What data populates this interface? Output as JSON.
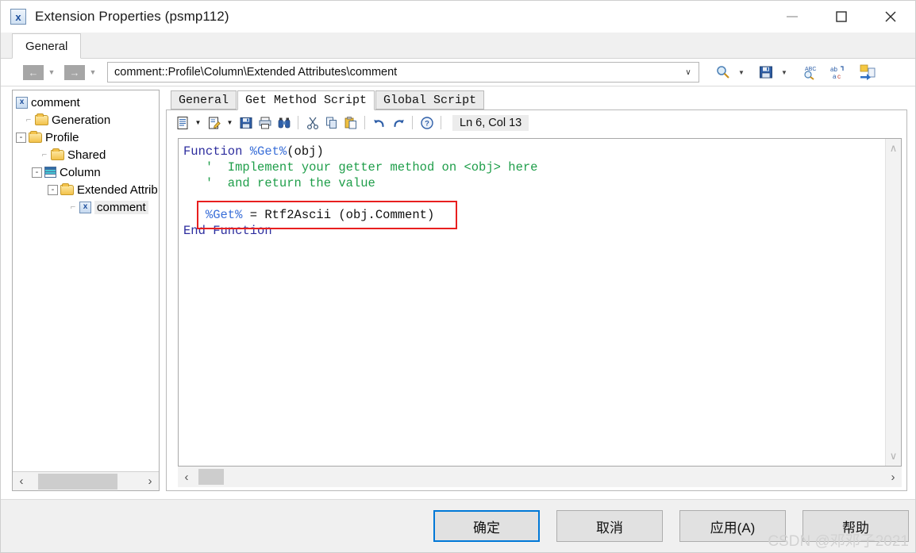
{
  "window": {
    "title": "Extension Properties (psmp112)",
    "app_icon_glyph": "x",
    "controls": {
      "minimize": "minimize-icon",
      "maximize": "maximize-icon",
      "close": "close-icon"
    }
  },
  "outer_tabs": [
    {
      "label": "General",
      "active": true
    }
  ],
  "navbar": {
    "back_label": "←",
    "forward_label": "→",
    "caret": "▼",
    "address_value": "comment::Profile\\Column\\Extended Attributes\\comment",
    "address_placeholder": "",
    "dropdown_caret": "∨",
    "tools": [
      {
        "name": "search-icon",
        "label": "Find"
      },
      {
        "name": "search-dropdown-caret",
        "label": "▼"
      },
      {
        "name": "save-icon",
        "label": "Save"
      },
      {
        "name": "save-dropdown-caret",
        "label": "▼"
      },
      {
        "name": "spell-check-icon",
        "label": "Check Spelling"
      },
      {
        "name": "replace-icon",
        "label": "Replace"
      },
      {
        "name": "export-icon",
        "label": "Export"
      }
    ]
  },
  "tree": {
    "nodes": [
      {
        "depth": 0,
        "expander": "",
        "icon": "xdoc",
        "label": "comment",
        "selected": false
      },
      {
        "depth": 1,
        "expander": "",
        "icon": "folder",
        "label": "Generation",
        "selected": false
      },
      {
        "depth": 0,
        "expander": "-",
        "icon": "folder",
        "label": "Profile",
        "selected": false
      },
      {
        "depth": 2,
        "expander": "",
        "icon": "folder",
        "label": "Shared",
        "selected": false
      },
      {
        "depth": 1,
        "expander": "-",
        "icon": "grid",
        "label": "Column",
        "selected": false
      },
      {
        "depth": 2,
        "expander": "-",
        "icon": "folder",
        "label": "Extended Attrib",
        "selected": false
      },
      {
        "depth": 4,
        "expander": "",
        "icon": "xdoc",
        "label": "comment",
        "selected": true
      }
    ],
    "hscroll": {
      "left_arrow": "‹",
      "right_arrow": "›"
    }
  },
  "inner_tabs": [
    {
      "label": "General",
      "active": false
    },
    {
      "label": "Get Method Script",
      "active": true
    },
    {
      "label": "Global Script",
      "active": false
    }
  ],
  "editor": {
    "toolbar": [
      {
        "name": "open-script-icon",
        "label": "Open"
      },
      {
        "name": "open-dropdown-caret",
        "label": "▼"
      },
      {
        "name": "edit-script-icon",
        "label": "Edit"
      },
      {
        "name": "edit-dropdown-caret",
        "label": "▼"
      },
      {
        "name": "save-script-icon",
        "label": "Save"
      },
      {
        "name": "print-icon",
        "label": "Print"
      },
      {
        "name": "find-binoculars-icon",
        "label": "Find"
      },
      {
        "name": "cut-icon",
        "label": "Cut"
      },
      {
        "name": "copy-icon",
        "label": "Copy"
      },
      {
        "name": "paste-icon",
        "label": "Paste"
      },
      {
        "name": "undo-icon",
        "label": "Undo"
      },
      {
        "name": "redo-icon",
        "label": "Redo"
      },
      {
        "name": "help-icon",
        "label": "Help"
      }
    ],
    "status": "Ln 6, Col 13",
    "code_lines": [
      {
        "segments": [
          {
            "text": "Function ",
            "style": "kw"
          },
          {
            "text": "%Get%",
            "style": "var"
          },
          {
            "text": "(obj)",
            "style": "plain"
          }
        ]
      },
      {
        "segments": [
          {
            "text": "   '  Implement your getter method on <obj> here",
            "style": "cmt"
          }
        ]
      },
      {
        "segments": [
          {
            "text": "   '  and return the value",
            "style": "cmt"
          }
        ]
      },
      {
        "segments": [
          {
            "text": "",
            "style": "plain"
          }
        ]
      },
      {
        "segments": [
          {
            "text": "   ",
            "style": "plain"
          },
          {
            "text": "%Get%",
            "style": "var"
          },
          {
            "text": " = Rtf2Ascii (obj.Comment)",
            "style": "plain"
          }
        ]
      },
      {
        "segments": [
          {
            "text": "End Function",
            "style": "kw"
          }
        ]
      }
    ],
    "highlight_note": "red-annotation-box",
    "vscroll": {
      "up_arrow": "∧",
      "down_arrow": "∨"
    },
    "hscroll": {
      "left_arrow": "‹",
      "right_arrow": "›"
    }
  },
  "footer": {
    "buttons": [
      {
        "name": "ok-button",
        "label": "确定",
        "default": true
      },
      {
        "name": "cancel-button",
        "label": "取消",
        "default": false
      },
      {
        "name": "apply-button",
        "label": "应用(A)",
        "default": false,
        "accel": "A"
      },
      {
        "name": "help-button",
        "label": "帮助",
        "default": false
      }
    ],
    "watermark": "CSDN @邓邓子2021"
  },
  "colors": {
    "accent": "#0078d7",
    "annotation": "#e81f1f",
    "keyword": "#2d2d9e",
    "variable": "#3a6fd8",
    "comment": "#1f9e4a"
  }
}
